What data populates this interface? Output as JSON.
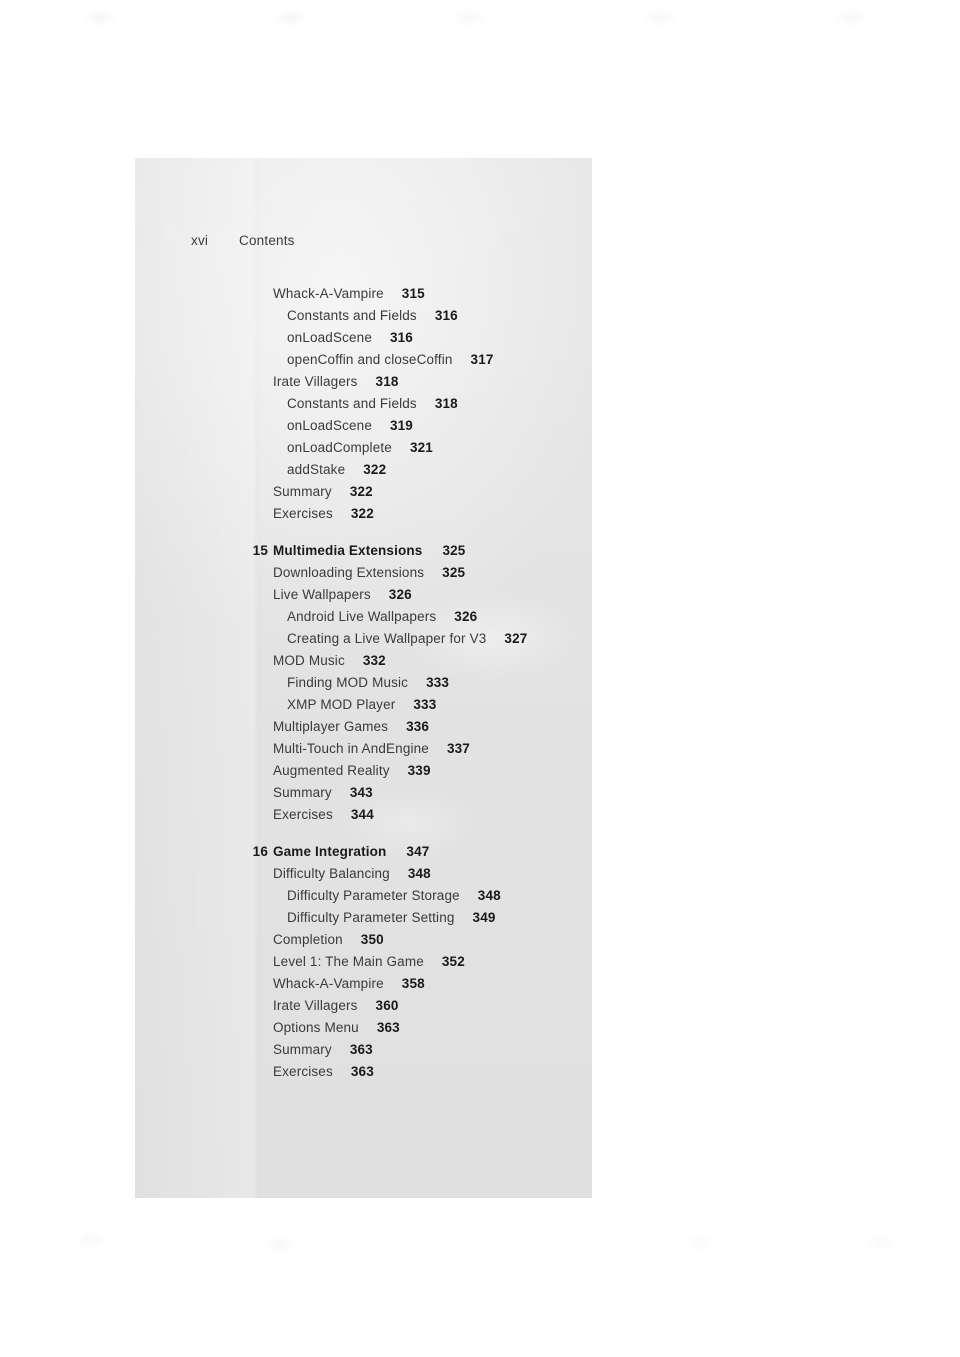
{
  "document": {
    "type": "book-table-of-contents",
    "page_background": "#e2e2e2",
    "surround_background": "#ffffff"
  },
  "header": {
    "folio": "xvi",
    "label": "Contents"
  },
  "toc": {
    "entries": [
      {
        "level": 1,
        "chapter": "",
        "title": "Whack-A-Vampire",
        "page": "315",
        "gap_before": false
      },
      {
        "level": 2,
        "chapter": "",
        "title": "Constants and Fields",
        "page": "316",
        "gap_before": false
      },
      {
        "level": 2,
        "chapter": "",
        "title": "onLoadScene",
        "page": "316",
        "gap_before": false
      },
      {
        "level": 2,
        "chapter": "",
        "title": "openCoffin and closeCoffin",
        "page": "317",
        "gap_before": false
      },
      {
        "level": 1,
        "chapter": "",
        "title": "Irate Villagers",
        "page": "318",
        "gap_before": false
      },
      {
        "level": 2,
        "chapter": "",
        "title": "Constants and Fields",
        "page": "318",
        "gap_before": false
      },
      {
        "level": 2,
        "chapter": "",
        "title": "onLoadScene",
        "page": "319",
        "gap_before": false
      },
      {
        "level": 2,
        "chapter": "",
        "title": "onLoadComplete",
        "page": "321",
        "gap_before": false
      },
      {
        "level": 2,
        "chapter": "",
        "title": "addStake",
        "page": "322",
        "gap_before": false
      },
      {
        "level": 1,
        "chapter": "",
        "title": "Summary",
        "page": "322",
        "gap_before": false
      },
      {
        "level": 1,
        "chapter": "",
        "title": "Exercises",
        "page": "322",
        "gap_before": false
      },
      {
        "level": 0,
        "chapter": "15",
        "title": "Multimedia Extensions",
        "page": "325",
        "gap_before": true
      },
      {
        "level": 1,
        "chapter": "",
        "title": "Downloading Extensions",
        "page": "325",
        "gap_before": false
      },
      {
        "level": 1,
        "chapter": "",
        "title": "Live Wallpapers",
        "page": "326",
        "gap_before": false
      },
      {
        "level": 2,
        "chapter": "",
        "title": "Android Live Wallpapers",
        "page": "326",
        "gap_before": false
      },
      {
        "level": 2,
        "chapter": "",
        "title": "Creating a Live Wallpaper for V3",
        "page": "327",
        "gap_before": false
      },
      {
        "level": 1,
        "chapter": "",
        "title": "MOD Music",
        "page": "332",
        "gap_before": false
      },
      {
        "level": 2,
        "chapter": "",
        "title": "Finding MOD Music",
        "page": "333",
        "gap_before": false
      },
      {
        "level": 2,
        "chapter": "",
        "title": "XMP MOD Player",
        "page": "333",
        "gap_before": false
      },
      {
        "level": 1,
        "chapter": "",
        "title": "Multiplayer Games",
        "page": "336",
        "gap_before": false
      },
      {
        "level": 1,
        "chapter": "",
        "title": "Multi-Touch in AndEngine",
        "page": "337",
        "gap_before": false
      },
      {
        "level": 1,
        "chapter": "",
        "title": "Augmented Reality",
        "page": "339",
        "gap_before": false
      },
      {
        "level": 1,
        "chapter": "",
        "title": "Summary",
        "page": "343",
        "gap_before": false
      },
      {
        "level": 1,
        "chapter": "",
        "title": "Exercises",
        "page": "344",
        "gap_before": false
      },
      {
        "level": 0,
        "chapter": "16",
        "title": "Game Integration",
        "page": "347",
        "gap_before": true
      },
      {
        "level": 1,
        "chapter": "",
        "title": "Difficulty Balancing",
        "page": "348",
        "gap_before": false
      },
      {
        "level": 2,
        "chapter": "",
        "title": "Difficulty Parameter Storage",
        "page": "348",
        "gap_before": false
      },
      {
        "level": 2,
        "chapter": "",
        "title": "Difficulty Parameter Setting",
        "page": "349",
        "gap_before": false
      },
      {
        "level": 1,
        "chapter": "",
        "title": "Completion",
        "page": "350",
        "gap_before": false
      },
      {
        "level": 1,
        "chapter": "",
        "title": "Level 1: The Main Game",
        "page": "352",
        "gap_before": false
      },
      {
        "level": 1,
        "chapter": "",
        "title": "Whack-A-Vampire",
        "page": "358",
        "gap_before": false
      },
      {
        "level": 1,
        "chapter": "",
        "title": "Irate Villagers",
        "page": "360",
        "gap_before": false
      },
      {
        "level": 1,
        "chapter": "",
        "title": "Options Menu",
        "page": "363",
        "gap_before": false
      },
      {
        "level": 1,
        "chapter": "",
        "title": "Summary",
        "page": "363",
        "gap_before": false
      },
      {
        "level": 1,
        "chapter": "",
        "title": "Exercises",
        "page": "363",
        "gap_before": false
      }
    ]
  }
}
